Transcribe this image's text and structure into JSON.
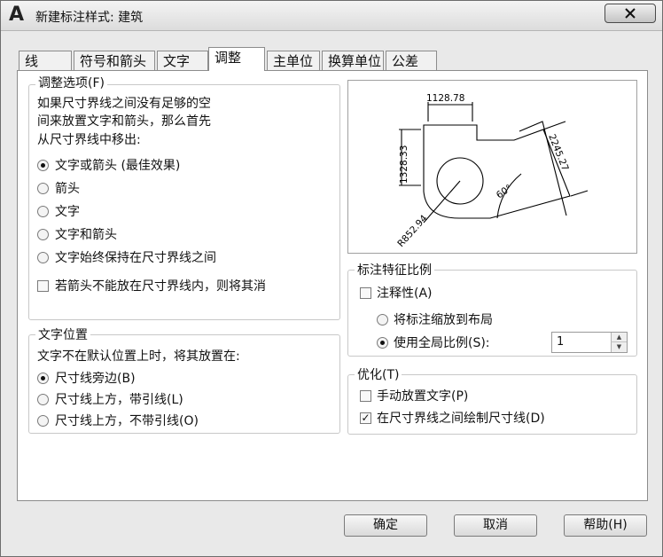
{
  "window": {
    "title": "新建标注样式: 建筑",
    "app_icon": "autocad-a-icon"
  },
  "tabs": [
    {
      "label": "线"
    },
    {
      "label": "符号和箭头"
    },
    {
      "label": "文字"
    },
    {
      "label": "调整",
      "active": true
    },
    {
      "label": "主单位"
    },
    {
      "label": "换算单位"
    },
    {
      "label": "公差"
    }
  ],
  "fit_options": {
    "legend": "调整选项(F)",
    "description": [
      "如果尺寸界线之间没有足够的空",
      "间来放置文字和箭头，那么首先",
      "从尺寸界线中移出:"
    ],
    "radios": [
      {
        "label": "文字或箭头 (最佳效果)",
        "selected": true
      },
      {
        "label": "箭头",
        "selected": false
      },
      {
        "label": "文字",
        "selected": false
      },
      {
        "label": "文字和箭头",
        "selected": false
      },
      {
        "label": "文字始终保持在尺寸界线之间",
        "selected": false
      }
    ],
    "checkbox": {
      "label": "若箭头不能放在尺寸界线内，则将其消",
      "checked": false
    }
  },
  "text_placement": {
    "legend": "文字位置",
    "description": "文字不在默认位置上时，将其放置在:",
    "radios": [
      {
        "label": "尺寸线旁边(B)",
        "selected": true
      },
      {
        "label": "尺寸线上方，带引线(L)",
        "selected": false
      },
      {
        "label": "尺寸线上方，不带引线(O)",
        "selected": false
      }
    ]
  },
  "preview": {
    "labels": {
      "top": "1128.78",
      "left": "1328.33",
      "right": "2245.27",
      "angle": "60°",
      "radius": "R852.94"
    }
  },
  "scale": {
    "legend": "标注特征比例",
    "annotative": {
      "label": "注释性(A)",
      "checked": false
    },
    "radios": [
      {
        "label": "将标注缩放到布局",
        "selected": false
      },
      {
        "label": "使用全局比例(S):",
        "selected": true
      }
    ],
    "global_value": "1"
  },
  "fine_tuning": {
    "legend": "优化(T)",
    "checks": [
      {
        "label": "手动放置文字(P)",
        "checked": false
      },
      {
        "label": "在尺寸界线之间绘制尺寸线(D)",
        "checked": true
      }
    ]
  },
  "buttons": {
    "ok": "确定",
    "cancel": "取消",
    "help": "帮助(H)"
  }
}
